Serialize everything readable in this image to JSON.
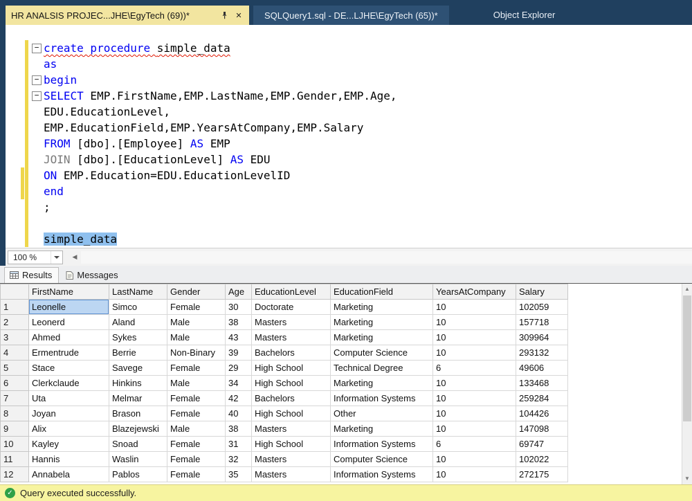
{
  "tabs": {
    "active_label": "HR ANALSIS PROJEC...JHE\\EgyTech (69))*",
    "inactive_label": "SQLQuery1.sql - DE...LJHE\\EgyTech (65))*",
    "object_explorer_label": "Object Explorer"
  },
  "editor": {
    "zoom_value": "100 %",
    "lines": [
      {
        "fold": true,
        "bar": true,
        "seg": [
          {
            "t": "create procedure",
            "c": "kw sq"
          },
          {
            "t": " ",
            "c": "id sq"
          },
          {
            "t": "simple_data",
            "c": "id sq"
          }
        ]
      },
      {
        "bar": true,
        "seg": [
          {
            "t": "as",
            "c": "kw"
          }
        ]
      },
      {
        "fold": true,
        "bar": true,
        "seg": [
          {
            "t": "begin",
            "c": "kw"
          }
        ]
      },
      {
        "fold": true,
        "bar": true,
        "seg": [
          {
            "t": "SELECT",
            "c": "kw"
          },
          {
            "t": " EMP.FirstName,EMP.LastName,EMP.Gender,EMP.Age,",
            "c": "id"
          }
        ]
      },
      {
        "bar": true,
        "seg": [
          {
            "t": "EDU.EducationLevel,",
            "c": "id"
          }
        ]
      },
      {
        "bar": true,
        "seg": [
          {
            "t": "EMP.EducationField,EMP.YearsAtCompany,EMP.Salary",
            "c": "id"
          }
        ]
      },
      {
        "bar": true,
        "seg": [
          {
            "t": "FROM",
            "c": "kw"
          },
          {
            "t": " [dbo].[Employee] ",
            "c": "id"
          },
          {
            "t": "AS",
            "c": "kw"
          },
          {
            "t": " EMP",
            "c": "id"
          }
        ]
      },
      {
        "bar": true,
        "seg": [
          {
            "t": "JOIN",
            "c": "gy"
          },
          {
            "t": " [dbo].[EducationLevel] ",
            "c": "id"
          },
          {
            "t": "AS",
            "c": "kw"
          },
          {
            "t": " EDU",
            "c": "id"
          }
        ]
      },
      {
        "bar": true,
        "wide": true,
        "seg": [
          {
            "t": "ON",
            "c": "kw"
          },
          {
            "t": " EMP.Education=EDU.EducationLevelID",
            "c": "id"
          }
        ]
      },
      {
        "bar": true,
        "wide": true,
        "seg": [
          {
            "t": "end",
            "c": "kw"
          }
        ]
      },
      {
        "bar": true,
        "seg": [
          {
            "t": ";",
            "c": "id"
          }
        ]
      },
      {
        "bar": true,
        "seg": []
      },
      {
        "bar": true,
        "seg": [
          {
            "t": "simple_data",
            "c": "id sel"
          }
        ]
      }
    ]
  },
  "results_pane": {
    "results_tab_label": "Results",
    "messages_tab_label": "Messages"
  },
  "grid": {
    "columns": [
      "FirstName",
      "LastName",
      "Gender",
      "Age",
      "EducationLevel",
      "EducationField",
      "YearsAtCompany",
      "Salary"
    ],
    "rows": [
      [
        "1",
        "Leonelle",
        "Simco",
        "Female",
        "30",
        "Doctorate",
        "Marketing",
        "10",
        "102059"
      ],
      [
        "2",
        "Leonerd",
        "Aland",
        "Male",
        "38",
        "Masters",
        "Marketing",
        "10",
        "157718"
      ],
      [
        "3",
        "Ahmed",
        "Sykes",
        "Male",
        "43",
        "Masters",
        "Marketing",
        "10",
        "309964"
      ],
      [
        "4",
        "Ermentrude",
        "Berrie",
        "Non-Binary",
        "39",
        "Bachelors",
        "Computer Science",
        "10",
        "293132"
      ],
      [
        "5",
        "Stace",
        "Savege",
        "Female",
        "29",
        "High School",
        "Technical Degree",
        "6",
        "49606"
      ],
      [
        "6",
        "Clerkclaude",
        "Hinkins",
        "Male",
        "34",
        "High School",
        "Marketing",
        "10",
        "133468"
      ],
      [
        "7",
        "Uta",
        "Melmar",
        "Female",
        "42",
        "Bachelors",
        "Information Systems",
        "10",
        "259284"
      ],
      [
        "8",
        "Joyan",
        "Brason",
        "Female",
        "40",
        "High School",
        "Other",
        "10",
        "104426"
      ],
      [
        "9",
        "Alix",
        "Blazejewski",
        "Male",
        "38",
        "Masters",
        "Marketing",
        "10",
        "147098"
      ],
      [
        "10",
        "Kayley",
        "Snoad",
        "Female",
        "31",
        "High School",
        "Information Systems",
        "6",
        "69747"
      ],
      [
        "11",
        "Hannis",
        "Waslin",
        "Female",
        "32",
        "Masters",
        "Computer Science",
        "10",
        "102022"
      ],
      [
        "12",
        "Annabela",
        "Pablos",
        "Female",
        "35",
        "Masters",
        "Information Systems",
        "10",
        "272175"
      ]
    ],
    "selected": {
      "row_index": 0,
      "col_index": 1
    }
  },
  "status": {
    "message": "Query executed successfully."
  },
  "colors": {
    "titlebar": "#20405f",
    "active_tab": "#f2e5a0",
    "keyword_blue": "#0000f2",
    "change_bar_yellow": "#eed64b",
    "status_bar_yellow": "#f7f4a0",
    "success_green": "#2fa148"
  }
}
